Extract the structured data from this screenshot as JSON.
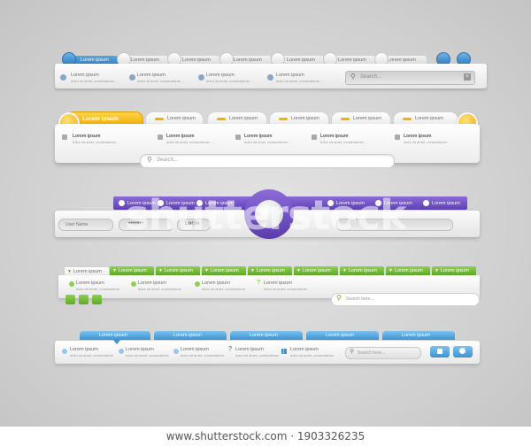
{
  "tab_label": "Lorem ipsum",
  "item_title": "Lorem ipsum",
  "item_desc": "dolor sit amet, consectetuer ...",
  "item_desc_short": "dolor sit amet, consectetuer",
  "search_placeholder": "Search...",
  "search_here": "Search here...",
  "user_name_label": "User Name",
  "password_dots": "•••••••",
  "login_label": "Login",
  "watermark": "shutterstock",
  "footer": "www.shutterstock.com · 1903326235",
  "colors": {
    "blue_accent": "#2f7cc2",
    "yellow_accent": "#f0a800",
    "purple_accent": "#5e40b3",
    "green_accent": "#5ea92a",
    "light_blue_accent": "#3c93d2"
  }
}
